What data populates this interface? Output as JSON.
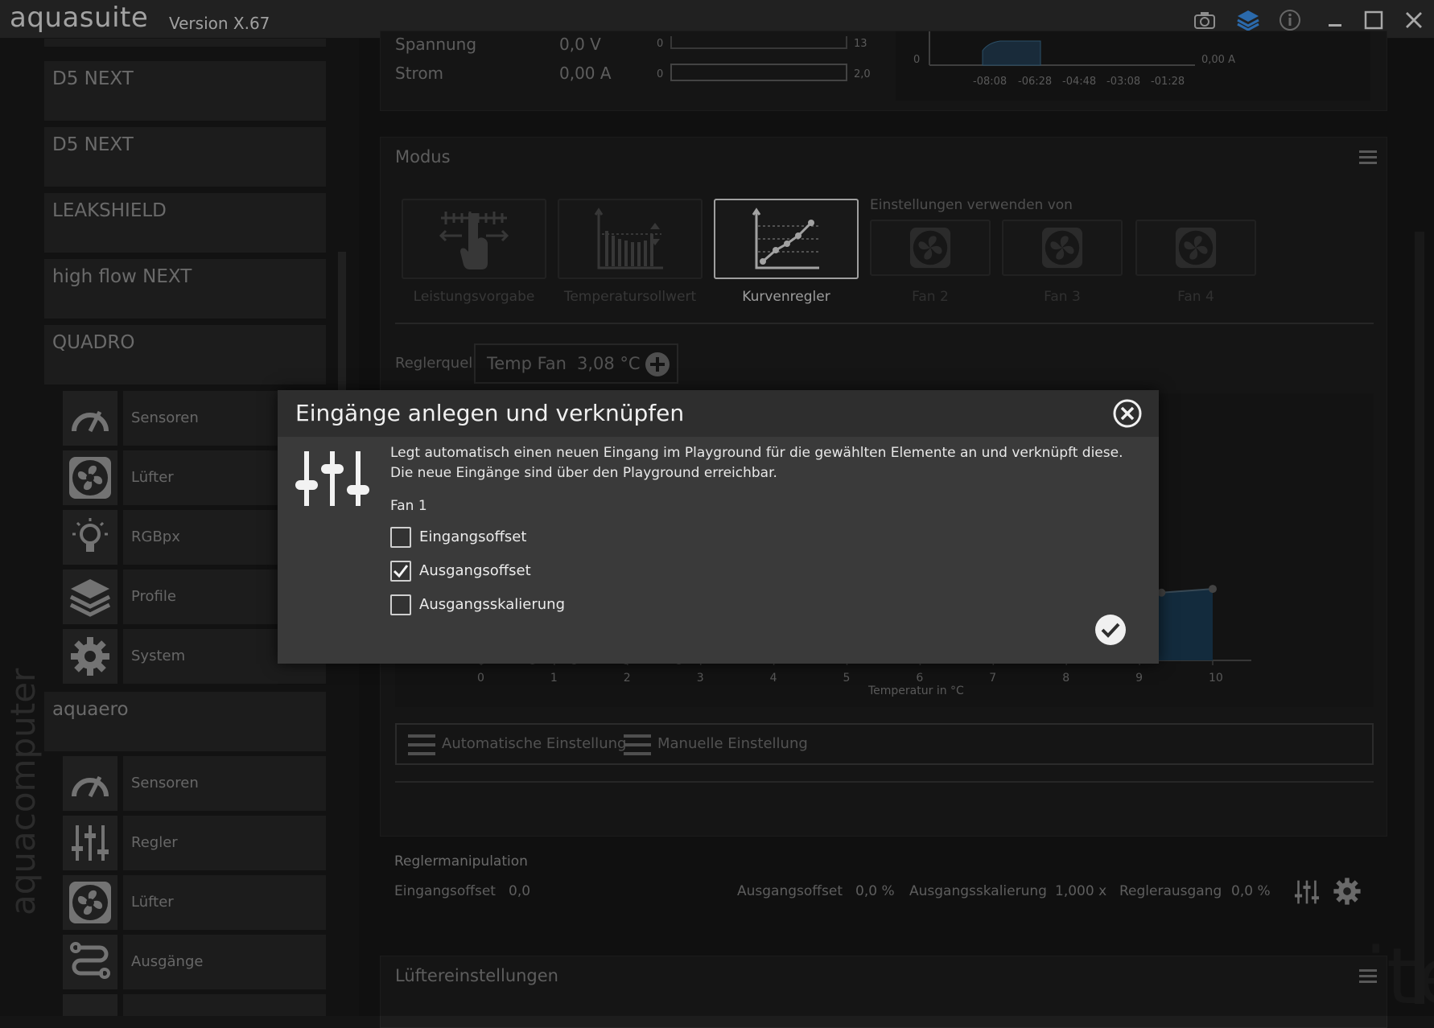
{
  "app": {
    "logo": "aquasuite",
    "version": "Version X.67",
    "brand_vertical": "aquacomputer"
  },
  "sidebar": {
    "devices": [
      {
        "label": "D5 NEXT"
      },
      {
        "label": "D5 NEXT"
      },
      {
        "label": "LEAKSHIELD"
      },
      {
        "label": "high flow NEXT"
      },
      {
        "label": "QUADRO"
      },
      {
        "label": "aquaero"
      }
    ],
    "quadro_items": [
      {
        "label": "Sensoren",
        "icon": "gauge-icon"
      },
      {
        "label": "Lüfter",
        "icon": "fan-icon"
      },
      {
        "label": "RGBpx",
        "icon": "bulb-icon"
      },
      {
        "label": "Profile",
        "icon": "layers-icon"
      },
      {
        "label": "System",
        "icon": "gear-icon"
      }
    ],
    "aquaero_items": [
      {
        "label": "Sensoren",
        "icon": "gauge-icon"
      },
      {
        "label": "Regler",
        "icon": "sliders-icon"
      },
      {
        "label": "Lüfter",
        "icon": "fan-icon"
      },
      {
        "label": "Ausgänge",
        "icon": "outputs-icon"
      }
    ]
  },
  "top_panel": {
    "spannung_label": "Spannung",
    "spannung_value": "0,0 V",
    "spannung_min": "0",
    "spannung_max": "13",
    "strom_label": "Strom",
    "strom_value": "0,00 A",
    "strom_min": "0",
    "strom_max": "2,0",
    "mini_chart": {
      "y_zero": "0",
      "y_right": "0,00 A",
      "x_ticks": [
        "-08:08",
        "-06:28",
        "-04:48",
        "-03:08",
        "-01:28"
      ]
    }
  },
  "modus_panel": {
    "title": "Modus",
    "modes": [
      {
        "label": "Leistungsvorgabe",
        "icon": "power-preset-icon"
      },
      {
        "label": "Temperatursollwert",
        "icon": "target-temp-icon"
      },
      {
        "label": "Kurvenregler",
        "icon": "curve-icon"
      }
    ],
    "use_settings_label": "Einstellungen verwenden von",
    "fans": [
      {
        "label": "Fan 2"
      },
      {
        "label": "Fan 3"
      },
      {
        "label": "Fan 4"
      }
    ],
    "source_label": "Reglerquelle",
    "source_name": "Temp Fan",
    "source_value": "3,08 °C",
    "auto_label": "Automatische Einstellung",
    "manual_label": "Manuelle Einstellung",
    "manipulation_title": "Reglermanipulation",
    "eingangsoffset_label": "Eingangsoffset",
    "eingangsoffset_value": "0,0",
    "ausgangsoffset_label": "Ausgangsoffset",
    "ausgangsoffset_value": "0,0 %",
    "ausgangsskalierung_label": "Ausgangsskalierung",
    "ausgangsskalierung_value": "1,000 x",
    "reglerausgang_label": "Reglerausgang",
    "reglerausgang_value": "0,0 %"
  },
  "chart_data": {
    "type": "area",
    "xlabel": "Temperatur in °C",
    "x_ticks": [
      "0",
      "1",
      "2",
      "3",
      "4",
      "5",
      "6",
      "7",
      "8",
      "9",
      "10"
    ],
    "xlim": [
      0,
      10
    ],
    "current_x": 3.5,
    "points_x": [
      0,
      0.7,
      1.27,
      1.98,
      2.7,
      3.3,
      4.0,
      4.7,
      5.3,
      8.0,
      8.7,
      9.3,
      10
    ],
    "points_y": [
      0,
      0,
      0,
      0,
      0,
      10,
      11,
      12.5,
      14,
      24,
      25.5,
      27,
      28.5
    ]
  },
  "lueftereinstellungen": {
    "title": "Lüftereinstellungen"
  },
  "watermark": "aquasuite",
  "dialog": {
    "title": "Eingänge anlegen und verknüpfen",
    "line1": "Legt automatisch einen neuen Eingang im Playground für die gewählten Elemente an und verknüpft diese.",
    "line2": "Die neue Eingänge sind über den Playground erreichbar.",
    "group": "Fan 1",
    "options": [
      {
        "label": "Eingangsoffset",
        "checked": false
      },
      {
        "label": "Ausgangsoffset",
        "checked": true
      },
      {
        "label": "Ausgangsskalierung",
        "checked": false
      }
    ]
  },
  "colors": {
    "accent": "#3a8ee6",
    "curve_fill": "#1a3a52",
    "dialog_bg": "#3a3a3a"
  }
}
